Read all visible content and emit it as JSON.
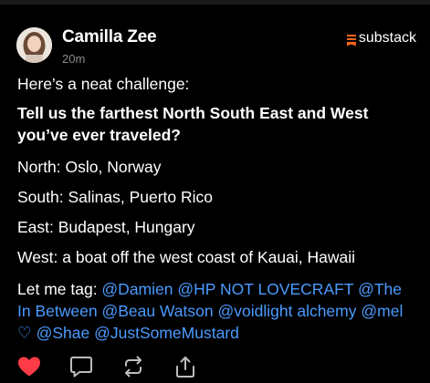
{
  "post": {
    "author": "Camilla Zee",
    "time": "20m",
    "brand": "substack",
    "intro": "Here’s a neat challenge:",
    "question": "Tell us the farthest North South East and West you’ve ever traveled?",
    "north": "North: Oslo, Norway",
    "south": "South: Salinas, Puerto Rico",
    "east": "East: Budapest, Hungary",
    "west": "West: a boat off the west coast of Kauai, Hawaii",
    "tag_prefix": "Let me tag: ",
    "mentions": [
      "@Damien",
      "@HP NOT LOVECRAFT",
      "@The In Between",
      "@Beau Watson",
      "@voidlight alchemy",
      "@mel ♡",
      "@Shae",
      "@JustSomeMustard"
    ]
  },
  "actions": {
    "like_icon": "heart-icon",
    "comment_icon": "comment-icon",
    "restack_icon": "restack-icon",
    "share_icon": "share-icon",
    "liked_color": "#ff3b48"
  },
  "colors": {
    "background": "#000000",
    "mention": "#4a9bff",
    "brand_accent": "#ff6719"
  }
}
